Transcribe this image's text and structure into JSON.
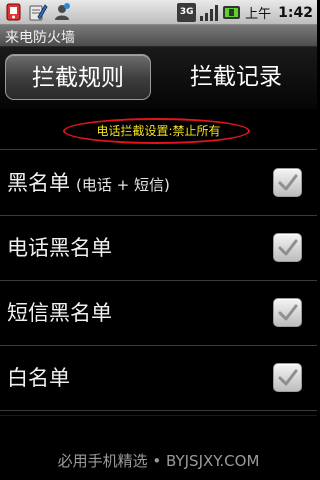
{
  "status_bar": {
    "network": "3G",
    "ampm": "上午",
    "time": "1:42",
    "icons": [
      "notification-app-icon",
      "notification-edit-icon",
      "notification-user-icon",
      "signal-icon",
      "battery-icon"
    ]
  },
  "title_bar": {
    "title": "来电防火墙"
  },
  "tabs": [
    {
      "label": "拦截规则",
      "selected": true
    },
    {
      "label": "拦截记录",
      "selected": false
    }
  ],
  "banner": {
    "text": "电话拦截设置:禁止所有",
    "text_color": "#f4e21b",
    "outline_color": "#e0141a"
  },
  "list": {
    "items": [
      {
        "label": "黑名单",
        "sublabel": "(电话 + 短信)",
        "checked": true
      },
      {
        "label": "电话黑名单",
        "sublabel": "",
        "checked": true
      },
      {
        "label": "短信黑名单",
        "sublabel": "",
        "checked": true
      },
      {
        "label": "白名单",
        "sublabel": "",
        "checked": true
      }
    ]
  },
  "footer": {
    "watermark": "必用手机精选 • BYJSJXY.COM"
  }
}
